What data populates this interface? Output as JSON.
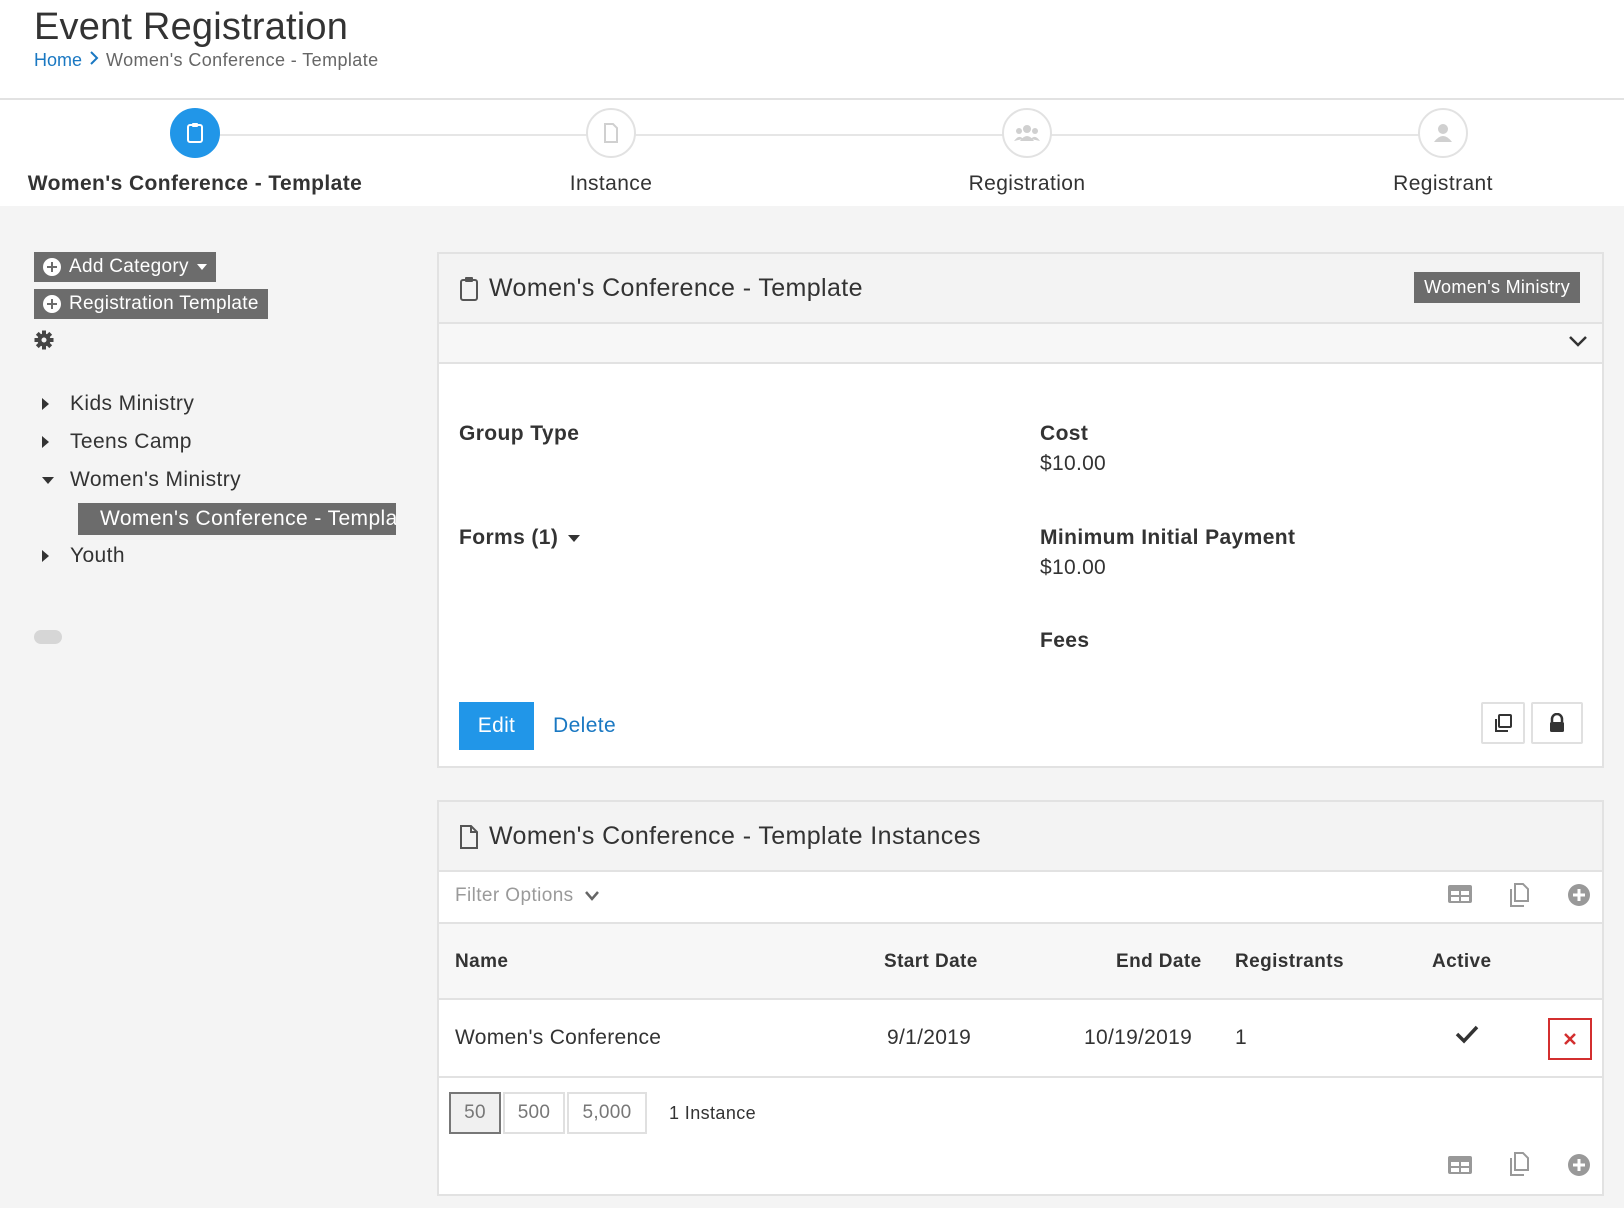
{
  "header": {
    "title": "Event Registration",
    "breadcrumb": {
      "home": "Home",
      "current": "Women's Conference - Template"
    }
  },
  "wizard": {
    "steps": [
      {
        "label": "Women's Conference - Template",
        "icon": "clipboard-icon",
        "active": true
      },
      {
        "label": "Instance",
        "icon": "file-icon",
        "active": false
      },
      {
        "label": "Registration",
        "icon": "users-icon",
        "active": false
      },
      {
        "label": "Registrant",
        "icon": "user-icon",
        "active": false
      }
    ]
  },
  "sidebar": {
    "add_category_label": "Add Category",
    "registration_template_label": "Registration Template",
    "tree": [
      {
        "label": "Kids Ministry",
        "expanded": false
      },
      {
        "label": "Teens Camp",
        "expanded": false
      },
      {
        "label": "Women's Ministry",
        "expanded": true,
        "children": [
          {
            "label": "Women's Conference - Template",
            "selected": true
          }
        ]
      },
      {
        "label": "Youth",
        "expanded": false
      }
    ]
  },
  "template_panel": {
    "title": "Women's Conference - Template",
    "category_label": "Women's Ministry",
    "fields": {
      "group_type_label": "Group Type",
      "forms_label": "Forms (1)",
      "cost_label": "Cost",
      "cost_value": "$10.00",
      "min_payment_label": "Minimum Initial Payment",
      "min_payment_value": "$10.00",
      "fees_label": "Fees"
    },
    "edit_label": "Edit",
    "delete_label": "Delete"
  },
  "instances_panel": {
    "title": "Women's Conference - Template Instances",
    "filter_label": "Filter Options",
    "columns": [
      "Name",
      "Start Date",
      "End Date",
      "Registrants",
      "Active"
    ],
    "rows": [
      {
        "name": "Women's Conference",
        "start": "9/1/2019",
        "end": "10/19/2019",
        "registrants": "1",
        "active": true
      }
    ],
    "page_sizes": [
      "50",
      "500",
      "5,000"
    ],
    "selected_page_size": "50",
    "count_text": "1 Instance"
  },
  "colors": {
    "accent": "#2196e8",
    "link": "#1a78c2",
    "label_bg": "#6c6c6c",
    "danger": "#d32f2f"
  }
}
